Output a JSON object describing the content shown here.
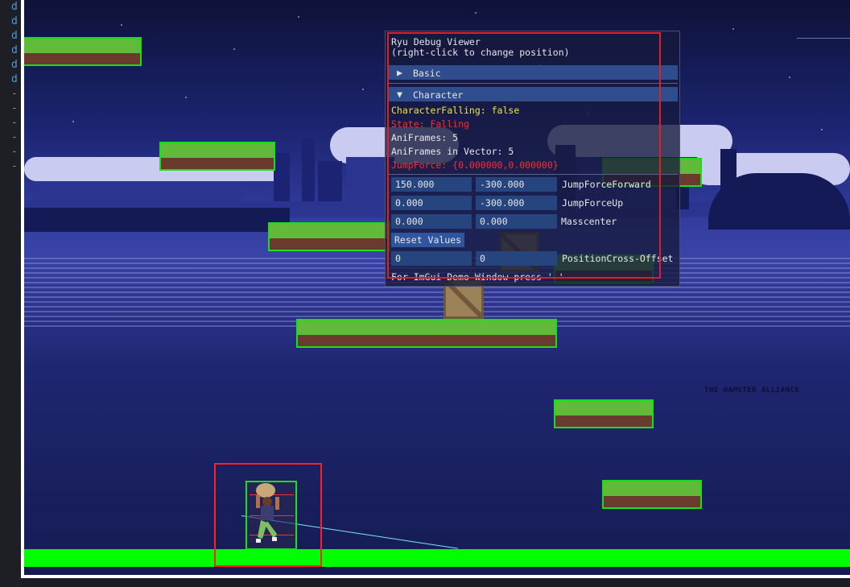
{
  "gutter": {
    "markers": [
      "d",
      "d",
      "d",
      "d",
      "d",
      "d",
      "-",
      "-",
      "-",
      "-",
      "-",
      "-"
    ]
  },
  "game": {
    "watermark": "THE HAMSTER ALLIANCE"
  },
  "debug_window": {
    "title_line1": "Ryu Debug Viewer",
    "title_line2": "(right-click to change position)",
    "sections": [
      {
        "label": "Basic",
        "arrow": "▶",
        "expanded": false
      },
      {
        "label": "Character",
        "arrow": "▼",
        "expanded": true
      }
    ],
    "status": {
      "character_falling": "CharacterFalling: false",
      "state": "State: Falling",
      "ani_frames": "AniFrames: 5",
      "ani_frames_vector": "AniFrames in Vector: 5",
      "jump_force": "JumpForce: {0.000000,0.000000}"
    },
    "fields": {
      "jump_force_forward": {
        "a": "150.000",
        "b": "-300.000",
        "label": "JumpForceForward"
      },
      "jump_force_up": {
        "a": "0.000",
        "b": "-300.000",
        "label": "JumpForceUp"
      },
      "masscenter": {
        "a": "0.000",
        "b": "0.000",
        "label": "Masscenter"
      },
      "position_cross_offset": {
        "a": "0",
        "b": "0",
        "label": "PositionCross-Offset"
      }
    },
    "reset_button": "Reset Values",
    "footer": "For ImGui-Demo-Window press '-'"
  },
  "colors": {
    "hitbox_green": "#18e018",
    "debug_red": "#ff2020",
    "grass": "#62ba3a",
    "dirt": "#6a3a2e",
    "ground": "#00ff00",
    "imgui_header": "#2f4d8c"
  }
}
